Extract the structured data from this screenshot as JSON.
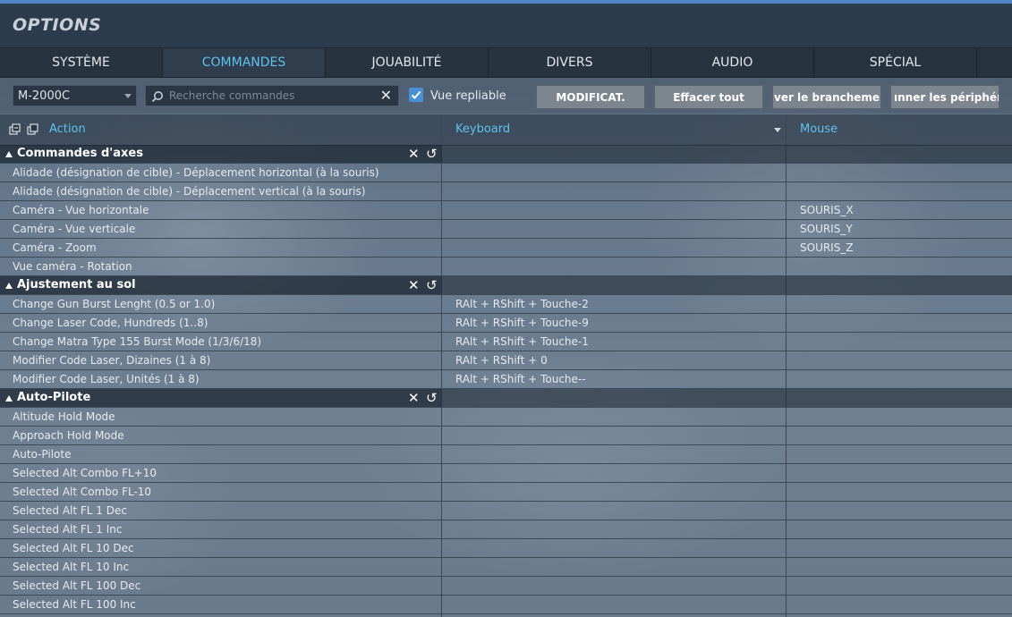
{
  "window": {
    "title": "OPTIONS"
  },
  "tabs": [
    {
      "label": "SYSTÈME"
    },
    {
      "label": "COMMANDES",
      "active": true
    },
    {
      "label": "JOUABILITÉ"
    },
    {
      "label": "DIVERS"
    },
    {
      "label": "AUDIO"
    },
    {
      "label": "SPÉCIAL"
    }
  ],
  "toolbar": {
    "aircraft_select": "M-2000C",
    "search_placeholder": "Recherche commandes",
    "search_clear_icon": "close-icon",
    "collapse_checkbox_label": "Vue repliable",
    "collapse_checked": true,
    "buttons": [
      "MODIFICAT.",
      "Effacer tout",
      "ver le branchement a",
      "ınner les périphéri"
    ]
  },
  "columns": {
    "action": "Action",
    "keyboard": "Keyboard",
    "mouse": "Mouse"
  },
  "categories": [
    {
      "name": "Commandes d'axes",
      "rows": [
        {
          "action": "Alidade (désignation de cible) - Déplacement horizontal (à la souris)",
          "keyboard": "",
          "mouse": ""
        },
        {
          "action": "Alidade (désignation de cible) - Déplacement vertical (à la souris)",
          "keyboard": "",
          "mouse": ""
        },
        {
          "action": "Caméra - Vue horizontale",
          "keyboard": "",
          "mouse": "SOURIS_X"
        },
        {
          "action": "Caméra - Vue verticale",
          "keyboard": "",
          "mouse": "SOURIS_Y"
        },
        {
          "action": "Caméra - Zoom",
          "keyboard": "",
          "mouse": "SOURIS_Z"
        },
        {
          "action": "Vue caméra - Rotation",
          "keyboard": "",
          "mouse": ""
        }
      ]
    },
    {
      "name": "Ajustement au sol",
      "rows": [
        {
          "action": "Change Gun Burst Lenght (0.5 or 1.0)",
          "keyboard": "RAlt + RShift + Touche-2",
          "mouse": ""
        },
        {
          "action": "Change Laser Code, Hundreds (1..8)",
          "keyboard": "RAlt + RShift + Touche-9",
          "mouse": ""
        },
        {
          "action": "Change Matra Type 155 Burst Mode (1/3/6/18)",
          "keyboard": "RAlt + RShift + Touche-1",
          "mouse": ""
        },
        {
          "action": "Modifier Code Laser, Dizaines (1 à 8)",
          "keyboard": "RAlt + RShift + 0",
          "mouse": ""
        },
        {
          "action": "Modifier Code Laser, Unités (1 à 8)",
          "keyboard": "RAlt + RShift + Touche--",
          "mouse": ""
        }
      ]
    },
    {
      "name": "Auto-Pilote",
      "rows": [
        {
          "action": "Altitude Hold Mode",
          "keyboard": "",
          "mouse": ""
        },
        {
          "action": "Approach Hold Mode",
          "keyboard": "",
          "mouse": ""
        },
        {
          "action": "Auto-Pilote",
          "keyboard": "",
          "mouse": ""
        },
        {
          "action": "Selected Alt Combo FL+10",
          "keyboard": "",
          "mouse": ""
        },
        {
          "action": "Selected Alt Combo FL-10",
          "keyboard": "",
          "mouse": ""
        },
        {
          "action": "Selected Alt FL 1 Dec",
          "keyboard": "",
          "mouse": ""
        },
        {
          "action": "Selected Alt FL 1 Inc",
          "keyboard": "",
          "mouse": ""
        },
        {
          "action": "Selected Alt FL 10 Dec",
          "keyboard": "",
          "mouse": ""
        },
        {
          "action": "Selected Alt FL 10 Inc",
          "keyboard": "",
          "mouse": ""
        },
        {
          "action": "Selected Alt FL 100 Dec",
          "keyboard": "",
          "mouse": ""
        },
        {
          "action": "Selected Alt FL 100 Inc",
          "keyboard": "",
          "mouse": ""
        }
      ]
    }
  ],
  "category_actions": {
    "clear_icon": "close-icon",
    "reset_icon": "reset-icon",
    "clear_glyph": "✕",
    "reset_glyph": "↺"
  },
  "colors": {
    "accent": "#5ec2ef",
    "titlebar": "#2d3c4d",
    "button": "#7d868f",
    "checkbox": "#4a90d6"
  }
}
